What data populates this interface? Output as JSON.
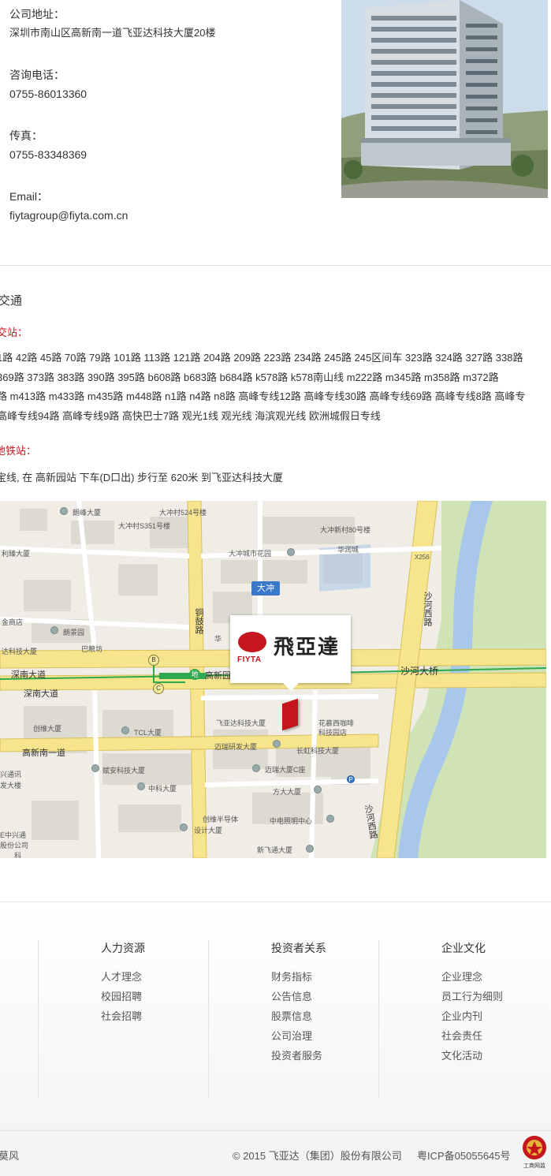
{
  "contact": {
    "address_label": "公司地址：",
    "address_value": "深圳市南山区高新南一道飞亚达科技大厦20楼",
    "phone_label": "咨询电话：",
    "phone_value": "0755-86013360",
    "fax_label": "传真：",
    "fax_value": "0755-83348369",
    "email_label": "Email：",
    "email_value": "fiytagroup@fiyta.com.cn"
  },
  "transport": {
    "title": "交通",
    "bus_heading": "交站：",
    "bus_lines": [
      "1路 42路 45路 70路 79路 101路 113路 121路 204路 209路 223路 234路 245路 245区间车 323路 324路 327路 338路",
      "369路 373路 383路 390路 395路 b608路 b683路 b684路 k578路 k578南山线 m222路 m345路 m358路 m372路",
      "路 m413路 m433路 m435路 m448路 n1路 n4路 n8路 高峰专线12路 高峰专线30路 高峰专线69路 高峰专线8路 高峰专",
      "高峰专线94路 高峰专线9路 高快巴士7路 观光1线 观光线 海滨观光线 欧洲城假日专线"
    ],
    "metro_heading": "地铁站：",
    "metro_text": "宝线, 在 高新园站 下车(D口出) 步行至 620米 到飞亚达科技大厦"
  },
  "map": {
    "labels": {
      "l1": "朗峰大厦",
      "l2": "大冲村524号楼",
      "l3": "大冲村S351号楼",
      "l4": "大冲新村80号楼",
      "l5": "利臻大厦",
      "l6": "大冲城市花园",
      "l7": "华润城",
      "l8": "X256",
      "l9": "大冲",
      "l10": "铜鼓路",
      "l11": "沙河西路",
      "l12": "金商店",
      "l13": "朗景园",
      "l14": "达科技大厦",
      "l15": "巴粮坊",
      "l16": "华",
      "l17": "深南大道",
      "l18": "高新园",
      "l19": "沙河大桥",
      "l20": "深南大道",
      "l21": "创维大厦",
      "l22": "TCL大厦",
      "l23": "飞亚达科技大厦",
      "l24": "花慕西咖啡",
      "l25": "科技园店",
      "l26": "高新南一道",
      "l27": "迈瑞研发大厦",
      "l28": "长虹科技大厦",
      "l29": "兴通讯",
      "l30": "发大楼",
      "l31": "赋安科技大厦",
      "l32": "迈瑞大厦C座",
      "l33": "中科大厦",
      "l34": "方大大厦",
      "l35": "中电照明中心",
      "l36": "E中兴通",
      "l37": "股份公司",
      "l38": "创维半导体",
      "l39": "设计大厦",
      "l40": "新飞通大厦",
      "l41": "科",
      "l42": "沙河西路"
    },
    "badge_text": "大冲",
    "logo_en": "FIYTA",
    "logo_cn": "飛亞達",
    "metro_mark": "地",
    "pill_b": "B",
    "pill_c": "C",
    "parking": "P"
  },
  "footer": {
    "col1": {
      "heading": "人力资源",
      "items": [
        "人才理念",
        "校园招聘",
        "社会招聘"
      ]
    },
    "col2": {
      "heading": "投资者关系",
      "items": [
        "财务指标",
        "公告信息",
        "股票信息",
        "公司治理",
        "投资者服务"
      ]
    },
    "col3": {
      "heading": "企业文化",
      "items": [
        "企业理念",
        "员工行为细则",
        "企业内刊",
        "社会责任",
        "文化活动"
      ]
    },
    "left_text": "莫风",
    "copyright": "© 2015 飞亚达（集团）股份有限公司",
    "icp": "粤ICP备05055645号",
    "badge_text": "工商网监"
  },
  "colors": {
    "accent_red": "#c4161c",
    "road_yellow": "#f6e58c",
    "water_blue": "#a9c7ea",
    "green_area": "#cfe3b6",
    "metro_green": "#2fa84f"
  }
}
